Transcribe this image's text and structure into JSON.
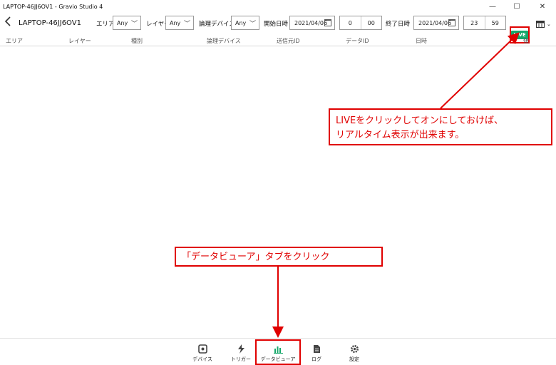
{
  "window": {
    "title": "LAPTOP-46JJ6OV1 - Gravio Studio 4",
    "controls": {
      "minimize": "—",
      "maximize": "☐",
      "close": "✕"
    }
  },
  "toolbar": {
    "back_icon": "chevron-left-icon",
    "device_name": "LAPTOP-46JJ6OV1",
    "area_label": "エリア",
    "area_value": "Any",
    "layer_label": "レイヤー",
    "layer_value": "Any",
    "logical_device_label": "論理デバイス",
    "logical_device_value": "Any",
    "start_label": "開始日時",
    "start_date": "2021/04/06",
    "start_hour": "0",
    "start_minute": "00",
    "end_label": "終了日時",
    "end_date": "2021/04/06",
    "end_hour": "23",
    "end_minute": "59",
    "live_label": "LIVE",
    "live_color": "#15a86a"
  },
  "table": {
    "columns": [
      "エリア",
      "レイヤー",
      "種別",
      "論理デバイス",
      "送信元ID",
      "データID",
      "日時",
      "値"
    ]
  },
  "annotations": {
    "live_note_line1": "LIVEをクリックしてオンにしておけば、",
    "live_note_line2": "リアルタイム表示が出来ます。",
    "tab_note": "「データビューア」タブをクリック",
    "color": "#e00000"
  },
  "bottom_nav": {
    "items": [
      {
        "label": "デバイス",
        "icon": "device-icon"
      },
      {
        "label": "トリガー",
        "icon": "trigger-icon"
      },
      {
        "label": "データビューア",
        "icon": "data-viewer-icon",
        "active": true
      },
      {
        "label": "ログ",
        "icon": "log-icon"
      },
      {
        "label": "設定",
        "icon": "settings-gear-icon"
      }
    ]
  }
}
